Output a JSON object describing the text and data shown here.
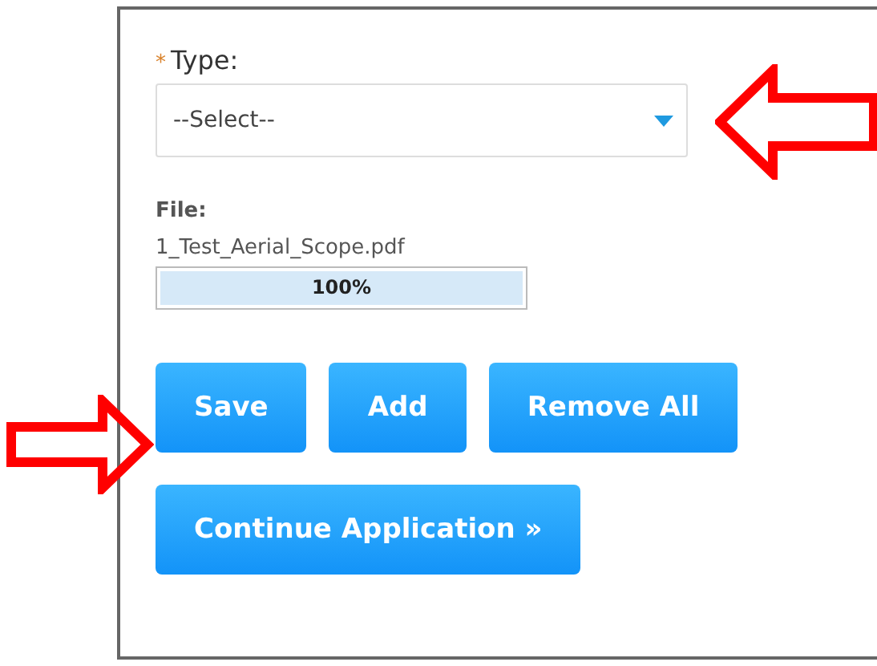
{
  "type_field": {
    "label": "Type:",
    "required_mark": "*",
    "value": "--Select--"
  },
  "file": {
    "label": "File:",
    "name": "1_Test_Aerial_Scope.pdf",
    "level": 1,
    "reading": "100%"
  },
  "buttons": [
    {
      "label": "Save"
    },
    {
      "label": "Add"
    },
    {
      "label": "Remove All"
    }
  ],
  "continue_button": {
    "label": "Continue Application »"
  }
}
